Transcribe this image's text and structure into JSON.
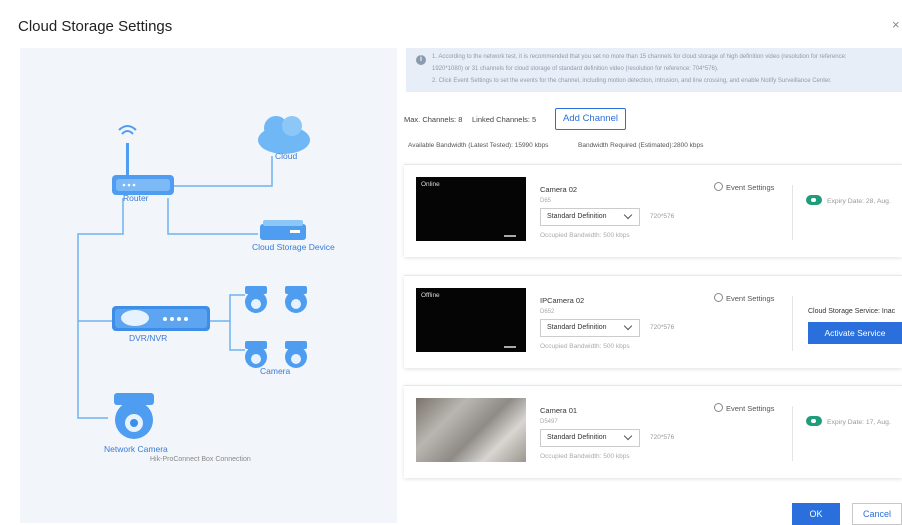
{
  "window": {
    "title": "Cloud Storage Settings",
    "close_glyph": "×"
  },
  "diagram": {
    "router": "Router",
    "cloud": "Cloud",
    "cloud_storage_device": "Cloud Storage Device",
    "dvr": "DVR/NVR",
    "camera": "Camera",
    "network_camera": "Network Camera",
    "box_connection": "Hik-ProConnect Box Connection",
    "accent_color": "#3a7bd5"
  },
  "notice": {
    "icon": "info-icon",
    "line1": "1. According to the network test, it is recommended that you set no more than 15 channels for cloud storage of high definition video (resolution for reference:",
    "line2": "1920*1080) or 31 channels for cloud storage of standard definition video (resolution for reference: 704*576).",
    "line3": "2. Click Event Settings to set the events for the channel, including motion detection, intrusion, and line crossing, and enable Notify Surveillance Center."
  },
  "summary": {
    "max_channels": "Max. Channels: 8",
    "linked_channels": "Linked Channels: 5",
    "add_channel": "Add Channel",
    "available_bandwidth": "Available Bandwidth (Latest Tested): 15990 kbps",
    "required_bandwidth": "Bandwidth Required (Estimated):2800 kbps"
  },
  "cameras": [
    {
      "state": "Online",
      "name": "Camera 02",
      "serial": "D65",
      "quality": "Standard Definition",
      "resolution": "720*576",
      "occupied": "Occupied Bandwidth: 500 kbps",
      "event_settings": "Event Settings",
      "expiry": "Expiry Date: 28, Aug."
    },
    {
      "state": "Offline",
      "name": "IPCamera 02",
      "serial": "D652",
      "quality": "Standard Definition",
      "resolution": "720*576",
      "occupied": "Occupied Bandwidth: 500 kbps",
      "event_settings": "Event Settings",
      "service_status": "Cloud Storage Service: Inac",
      "activate": "Activate Service"
    },
    {
      "state": "",
      "name": "Camera 01",
      "serial": "D5497",
      "quality": "Standard Definition",
      "resolution": "720*576",
      "occupied": "Occupied Bandwidth: 500 kbps",
      "event_settings": "Event Settings",
      "expiry": "Expiry Date: 17, Aug."
    }
  ],
  "footer": {
    "ok": "OK",
    "cancel": "Cancel"
  },
  "colors": {
    "primary": "#2a6fdb",
    "badge_green": "#1f9d7a"
  }
}
